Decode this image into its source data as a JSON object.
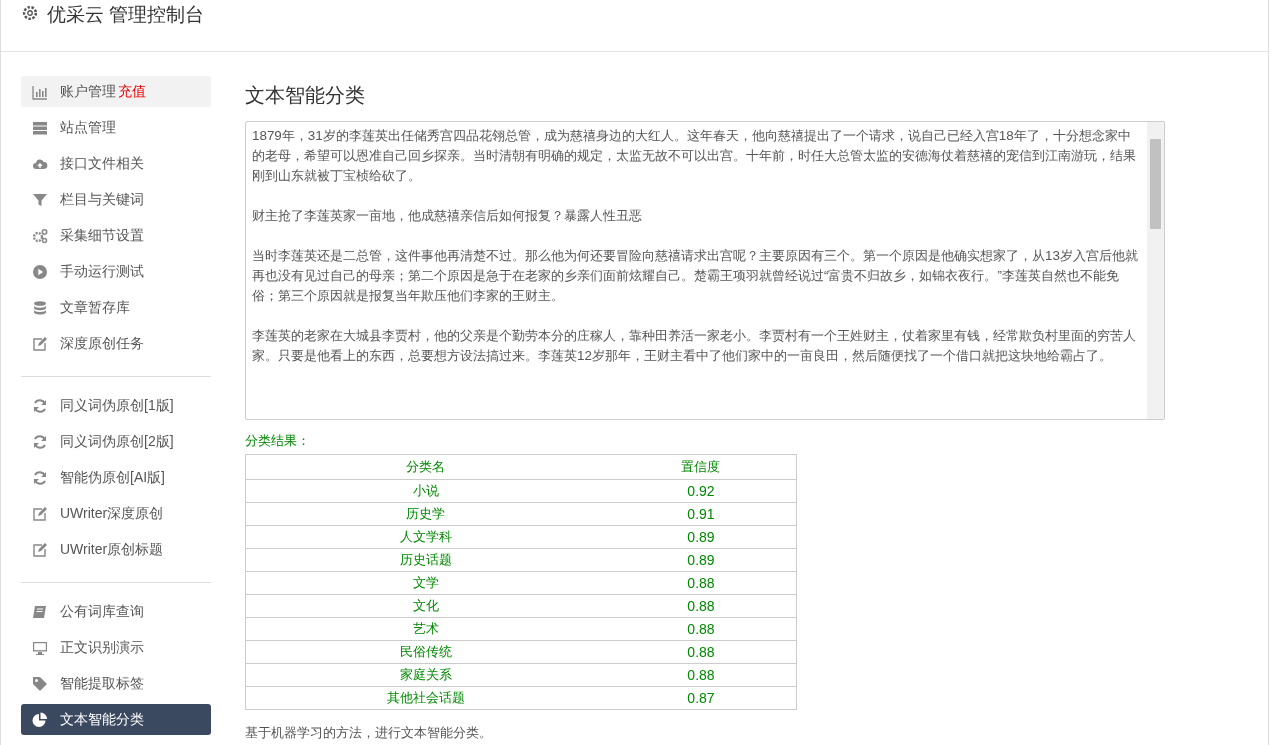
{
  "header": {
    "title": "优采云 管理控制台"
  },
  "sidebar": {
    "groups": [
      {
        "items": [
          {
            "label": "账户管理",
            "badge": "充值",
            "kind": "chart",
            "hovered": true,
            "selected": false
          },
          {
            "label": "站点管理",
            "kind": "server",
            "hovered": false,
            "selected": false
          },
          {
            "label": "接口文件相关",
            "kind": "cloud",
            "hovered": false,
            "selected": false
          },
          {
            "label": "栏目与关键词",
            "kind": "filter",
            "hovered": false,
            "selected": false
          },
          {
            "label": "采集细节设置",
            "kind": "gears",
            "hovered": false,
            "selected": false
          },
          {
            "label": "手动运行测试",
            "kind": "play",
            "hovered": false,
            "selected": false
          },
          {
            "label": "文章暂存库",
            "kind": "database",
            "hovered": false,
            "selected": false
          },
          {
            "label": "深度原创任务",
            "kind": "edit",
            "hovered": false,
            "selected": false
          }
        ]
      },
      {
        "items": [
          {
            "label": "同义词伪原创[1版]",
            "kind": "refresh",
            "hovered": false,
            "selected": false
          },
          {
            "label": "同义词伪原创[2版]",
            "kind": "refresh",
            "hovered": false,
            "selected": false
          },
          {
            "label": "智能伪原创[AI版]",
            "kind": "refresh",
            "hovered": false,
            "selected": false
          },
          {
            "label": "UWriter深度原创",
            "kind": "edit",
            "hovered": false,
            "selected": false
          },
          {
            "label": "UWriter原创标题",
            "kind": "edit",
            "hovered": false,
            "selected": false
          }
        ]
      },
      {
        "items": [
          {
            "label": "公有词库查询",
            "kind": "book",
            "hovered": false,
            "selected": false
          },
          {
            "label": "正文识别演示",
            "kind": "monitor",
            "hovered": false,
            "selected": false
          },
          {
            "label": "智能提取标签",
            "kind": "tag",
            "hovered": false,
            "selected": false
          },
          {
            "label": "文本智能分类",
            "kind": "pie",
            "hovered": false,
            "selected": true
          }
        ]
      }
    ]
  },
  "main": {
    "title": "文本智能分类",
    "article": {
      "paragraphs": [
        "1879年，31岁的李莲英出任储秀宫四品花翎总管，成为慈禧身边的大红人。这年春天，他向慈禧提出了一个请求，说自己已经入宫18年了，十分想念家中的老母，希望可以恩准自己回乡探亲。当时清朝有明确的规定，太监无故不可以出宫。十年前，时任大总管太监的安德海仗着慈禧的宠信到江南游玩，结果刚到山东就被丁宝桢给砍了。",
        "财主抢了李莲英家一亩地，他成慈禧亲信后如何报复？暴露人性丑恶",
        "当时李莲英还是二总管，这件事他再清楚不过。那么他为何还要冒险向慈禧请求出宫呢？主要原因有三个。第一个原因是他确实想家了，从13岁入宫后他就再也没有见过自己的母亲；第二个原因是急于在老家的乡亲们面前炫耀自己。楚霸王项羽就曾经说过“富贵不归故乡，如锦衣夜行。”李莲英自然也不能免俗；第三个原因就是报复当年欺压他们李家的王财主。",
        "李莲英的老家在大城县李贾村，他的父亲是个勤劳本分的庄稼人，靠种田养活一家老小。李贾村有一个王姓财主，仗着家里有钱，经常欺负村里面的穷苦人家。只要是他看上的东西，总要想方设法搞过来。李莲英12岁那年，王财主看中了他们家中的一亩良田，然后随便找了一个借口就把这块地给霸占了。"
      ]
    },
    "results_label": "分类结果：",
    "table": {
      "columns": [
        "分类名",
        "置信度"
      ],
      "rows": [
        [
          "小说",
          "0.92"
        ],
        [
          "历史学",
          "0.91"
        ],
        [
          "人文学科",
          "0.89"
        ],
        [
          "历史话题",
          "0.89"
        ],
        [
          "文学",
          "0.88"
        ],
        [
          "文化",
          "0.88"
        ],
        [
          "艺术",
          "0.88"
        ],
        [
          "民俗传统",
          "0.88"
        ],
        [
          "家庭关系",
          "0.88"
        ],
        [
          "其他社会话题",
          "0.87"
        ]
      ]
    },
    "description": "基于机器学习的方法，进行文本智能分类。"
  }
}
